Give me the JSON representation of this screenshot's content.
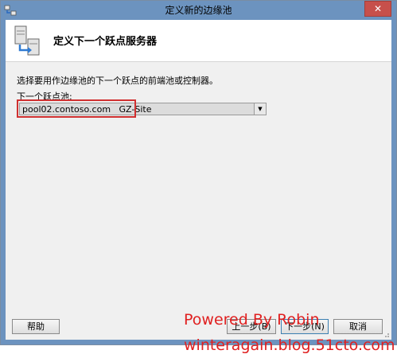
{
  "window": {
    "title": "定义新的边缘池",
    "close_glyph": "✕",
    "app_icon": "wizard-app-icon"
  },
  "header": {
    "title": "定义下一个跃点服务器",
    "icon": "server-arrow-icon"
  },
  "body": {
    "description": "选择要用作边缘池的下一个跃点的前端池或控制器。",
    "field_label": "下一个跃点池:",
    "select_value": "pool02.contoso.com   GZ-Site",
    "select_arrow_glyph": "▼"
  },
  "buttons": {
    "help": "帮助",
    "back": "上一步(B)",
    "next": "下一步(N)",
    "cancel": "取消"
  },
  "watermark": {
    "line1": "Powered By Robin",
    "line2": "winteragain.blog.51cto.com"
  },
  "colors": {
    "title_bar": "#6c93bf",
    "close_button": "#c7504b",
    "highlight": "#d03030",
    "watermark": "#e02020"
  }
}
